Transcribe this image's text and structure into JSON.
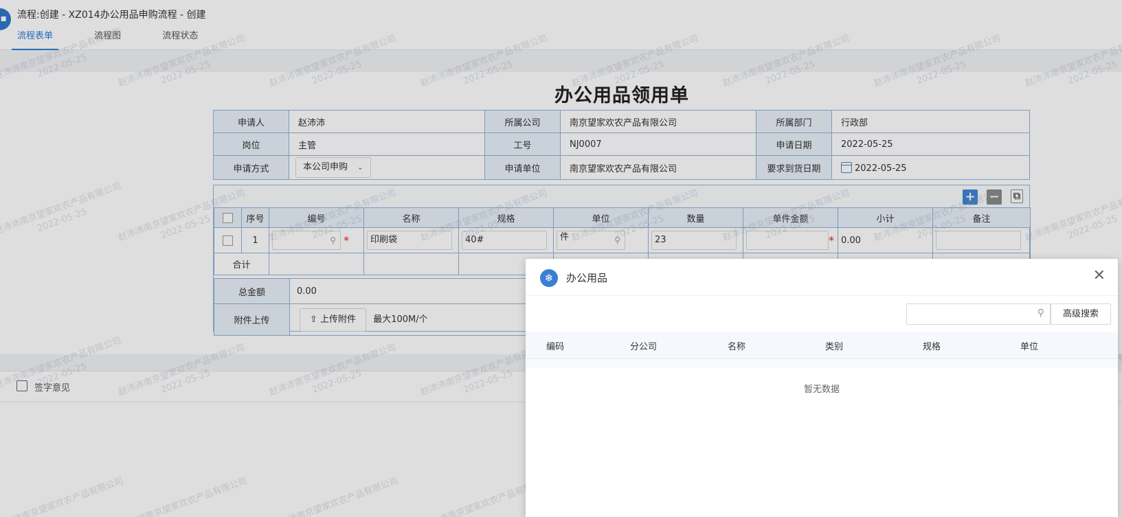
{
  "header": {
    "title": "流程:创建 - XZ014办公用品申购流程 - 创建",
    "tabs": [
      {
        "label": "流程表单",
        "active": true
      },
      {
        "label": "流程图",
        "active": false
      },
      {
        "label": "流程状态",
        "active": false
      }
    ]
  },
  "form": {
    "title": "办公用品领用单",
    "info": {
      "applicant_label": "申请人",
      "applicant": "赵沛沛",
      "company_label": "所属公司",
      "company": "南京望家欢农产品有限公司",
      "dept_label": "所属部门",
      "dept": "行政部",
      "post_label": "岗位",
      "post": "主管",
      "empno_label": "工号",
      "empno": "NJ0007",
      "date_label": "申请日期",
      "date": "2022-05-25",
      "method_label": "申请方式",
      "method": "本公司申购",
      "unit_label": "申请单位",
      "unit": "南京望家欢农产品有限公司",
      "arrival_label": "要求到货日期",
      "arrival": "2022-05-25"
    },
    "detail": {
      "headers": [
        "序号",
        "编号",
        "名称",
        "规格",
        "单位",
        "数量",
        "单件金额",
        "小计",
        "备注"
      ],
      "row": {
        "index": "1",
        "code": "",
        "name": "印刷袋",
        "spec": "40#",
        "unit": "件",
        "qty": "23",
        "price": "",
        "subtotal": "0.00",
        "remark": ""
      },
      "sum_label": "合计"
    },
    "total_label": "总金额",
    "total_value": "0.00",
    "attach_label": "附件上传",
    "upload_button": "上传附件",
    "upload_hint": "最大100M/个"
  },
  "sign": {
    "label": "签字意见"
  },
  "watermark": {
    "line1": "赵沛沛南京望家欢农产品有限公司",
    "line2": "2022-05-25"
  },
  "modal": {
    "title": "办公用品",
    "search_placeholder": "",
    "advanced_button": "高级搜索",
    "columns": [
      "编码",
      "分公司",
      "名称",
      "类别",
      "规格",
      "单位"
    ],
    "empty_text": "暂无数据"
  }
}
